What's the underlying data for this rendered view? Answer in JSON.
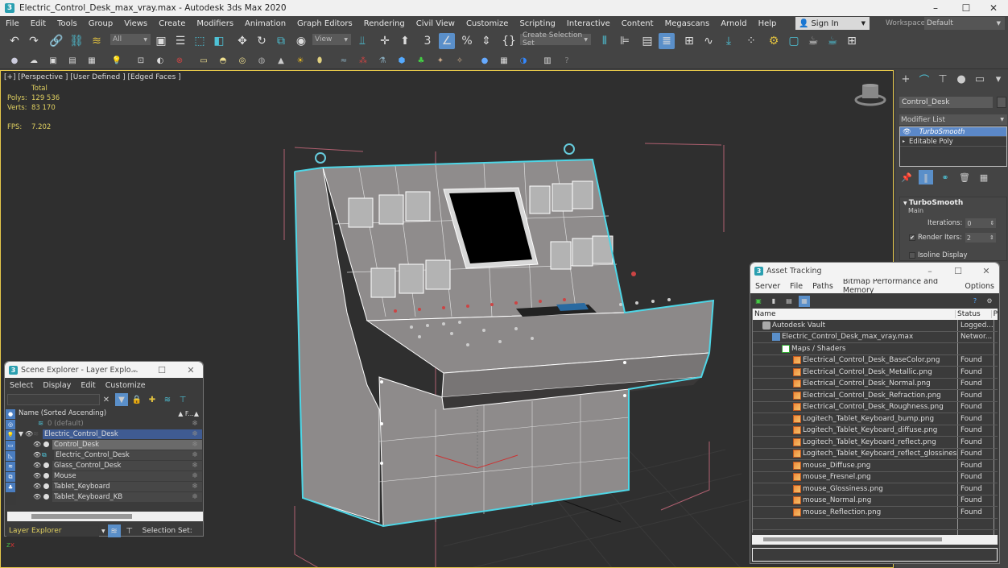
{
  "window": {
    "title": "Electric_Control_Desk_max_vray.max - Autodesk 3ds Max 2020",
    "app_icon": "3",
    "minimize_icon": "–",
    "maximize_icon": "☐",
    "close_icon": "✕"
  },
  "menubar": {
    "items": [
      "File",
      "Edit",
      "Tools",
      "Group",
      "Views",
      "Create",
      "Modifiers",
      "Animation",
      "Graph Editors",
      "Rendering",
      "Civil View",
      "Customize",
      "Scripting",
      "Interactive",
      "Content",
      "Megascans",
      "Arnold",
      "Help"
    ],
    "sign_in": "Sign In",
    "workspaces_label": "Workspaces:",
    "workspace_value": "Default"
  },
  "toolbar": {
    "selection_filter": "All",
    "reference_coord": "View",
    "named_selection": "Create Selection Set"
  },
  "viewport": {
    "label": "[+] [Perspective ] [User Defined ] [Edged Faces ]",
    "stats_header": "Total",
    "polys_label": "Polys:",
    "polys_value": "129 536",
    "verts_label": "Verts:",
    "verts_value": "83 170",
    "fps_label": "FPS:",
    "fps_value": "7.202"
  },
  "command_panel": {
    "object_name": "Control_Desk",
    "modifier_list_label": "Modifier List",
    "stack": [
      "TurboSmooth",
      "Editable Poly"
    ],
    "rollout_title": "TurboSmooth",
    "group_main": "Main",
    "iterations_label": "Iterations:",
    "iterations_value": "0",
    "render_iters_label": "Render Iters:",
    "render_iters_value": "2",
    "render_iters_checked": true,
    "isoline_label": "Isoline Display",
    "isoline_checked": false
  },
  "scene_explorer": {
    "title": "Scene Explorer - Layer Explo...",
    "menu": [
      "Select",
      "Display",
      "Edit",
      "Customize"
    ],
    "column_name": "Name (Sorted Ascending)",
    "column_frozen": "▲ F...▲",
    "rows": [
      {
        "name": "0 (default)",
        "type": "layer-dim"
      },
      {
        "name": "Electric_Control_Desk",
        "type": "layer"
      },
      {
        "name": "Control_Desk",
        "type": "object-selected"
      },
      {
        "name": "Electric_Control_Desk",
        "type": "group"
      },
      {
        "name": "Glass_Control_Desk",
        "type": "object"
      },
      {
        "name": "Mouse",
        "type": "object"
      },
      {
        "name": "Tablet_Keyboard",
        "type": "object"
      },
      {
        "name": "Tablet_Keyboard_KB",
        "type": "object"
      }
    ],
    "footer_dropdown": "Layer Explorer",
    "footer_label": "Selection Set:"
  },
  "asset_tracking": {
    "title": "Asset Tracking",
    "menu": [
      "Server",
      "File",
      "Paths",
      "Bitmap Performance and Memory",
      "Options"
    ],
    "columns": [
      "Name",
      "Status",
      "P"
    ],
    "rows": [
      {
        "name": "Autodesk Vault",
        "status": "Logged...",
        "indent": 1,
        "icon": "vault"
      },
      {
        "name": "Electric_Control_Desk_max_vray.max",
        "status": "Networ...",
        "indent": 2,
        "icon": "max"
      },
      {
        "name": "Maps / Shaders",
        "status": "",
        "indent": 3,
        "icon": "folder"
      },
      {
        "name": "Electrical_Control_Desk_BaseColor.png",
        "status": "Found",
        "indent": 4,
        "icon": "png"
      },
      {
        "name": "Electrical_Control_Desk_Metallic.png",
        "status": "Found",
        "indent": 4,
        "icon": "png"
      },
      {
        "name": "Electrical_Control_Desk_Normal.png",
        "status": "Found",
        "indent": 4,
        "icon": "png"
      },
      {
        "name": "Electrical_Control_Desk_Refraction.png",
        "status": "Found",
        "indent": 4,
        "icon": "png"
      },
      {
        "name": "Electrical_Control_Desk_Roughness.png",
        "status": "Found",
        "indent": 4,
        "icon": "png"
      },
      {
        "name": "Logitech_Tablet_Keyboard_bump.png",
        "status": "Found",
        "indent": 4,
        "icon": "png"
      },
      {
        "name": "Logitech_Tablet_Keyboard_diffuse.png",
        "status": "Found",
        "indent": 4,
        "icon": "png"
      },
      {
        "name": "Logitech_Tablet_Keyboard_reflect.png",
        "status": "Found",
        "indent": 4,
        "icon": "png"
      },
      {
        "name": "Logitech_Tablet_Keyboard_reflect_glossiness.png",
        "status": "Found",
        "indent": 4,
        "icon": "png"
      },
      {
        "name": "mouse_Diffuse.png",
        "status": "Found",
        "indent": 4,
        "icon": "png"
      },
      {
        "name": "mouse_Fresnel.png",
        "status": "Found",
        "indent": 4,
        "icon": "png"
      },
      {
        "name": "mouse_Glossiness.png",
        "status": "Found",
        "indent": 4,
        "icon": "png"
      },
      {
        "name": "mouse_Normal.png",
        "status": "Found",
        "indent": 4,
        "icon": "png"
      },
      {
        "name": "mouse_Reflection.png",
        "status": "Found",
        "indent": 4,
        "icon": "png"
      }
    ]
  },
  "colors": {
    "accent": "#5a8fc9",
    "selection_wire": "#4ed6e6",
    "stats_text": "#e0d060",
    "viewport_border": "#e5c74a"
  }
}
